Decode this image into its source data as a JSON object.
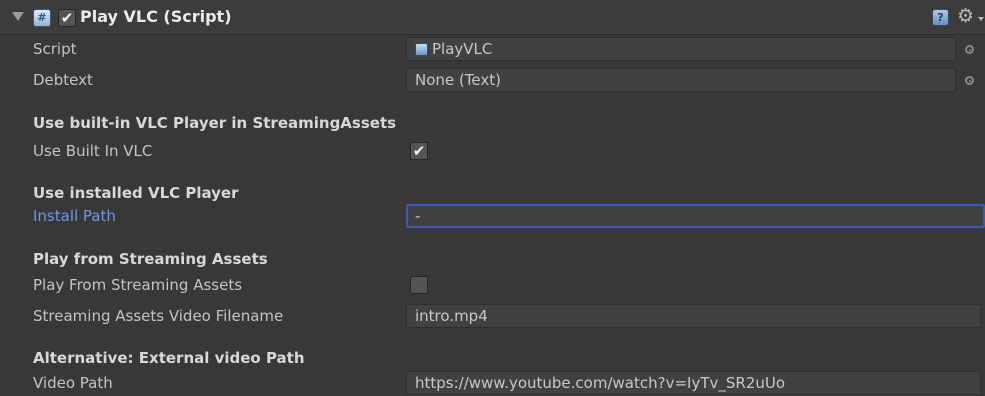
{
  "component": {
    "title": "Play VLC (Script)",
    "enabled": true,
    "icon": "script-icon",
    "header_check_glyph": "✔",
    "help_glyph": "?",
    "gear_glyph": "⚙"
  },
  "fields": {
    "script": {
      "label": "Script",
      "value": "PlayVLC"
    },
    "debtext": {
      "label": "Debtext",
      "value": "None (Text)"
    },
    "use_built_in_vlc": {
      "label": "Use Built In VLC",
      "checked": true,
      "glyph": "✔"
    },
    "install_path": {
      "label": "Install Path",
      "value": "-"
    },
    "play_from_streaming_assets": {
      "label": "Play From Streaming Assets",
      "checked": false,
      "glyph": ""
    },
    "streaming_assets_video_filename": {
      "label": "Streaming Assets Video Filename",
      "value": "intro.mp4"
    },
    "video_path": {
      "label": "Video Path",
      "value": "https://www.youtube.com/watch?v=IyTv_SR2uUo"
    }
  },
  "sections": {
    "built_in": "Use built-in VLC Player in StreamingAssets",
    "installed": "Use installed VLC Player",
    "streaming": "Play from Streaming Assets",
    "external": "Alternative: External video Path"
  },
  "colors": {
    "background": "#383838",
    "focus_accent": "#3f58b8",
    "focused_label": "#6c97e8"
  }
}
